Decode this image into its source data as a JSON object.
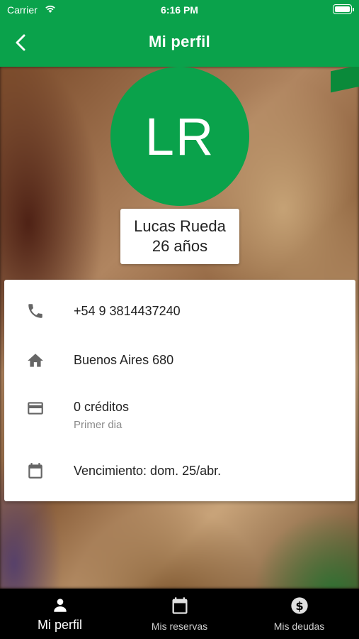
{
  "status_bar": {
    "carrier": "Carrier",
    "time": "6:16 PM"
  },
  "header": {
    "title": "Mi perfil",
    "back_icon": "chevron-left-icon"
  },
  "profile": {
    "initials": "LR",
    "name": "Lucas Rueda",
    "age": "26 años"
  },
  "info": {
    "phone": {
      "icon": "phone-icon",
      "text": "+54 9 3814437240"
    },
    "address": {
      "icon": "home-icon",
      "text": "Buenos Aires 680"
    },
    "credits": {
      "icon": "credit-card-icon",
      "text": "0 créditos",
      "subtext": "Primer dia"
    },
    "expiry": {
      "icon": "calendar-icon",
      "text": "Vencimiento: dom. 25/abr."
    }
  },
  "tabs": [
    {
      "label": "Mi perfil",
      "icon": "person-icon",
      "active": true
    },
    {
      "label": "Mis reservas",
      "icon": "calendar-icon",
      "active": false
    },
    {
      "label": "Mis deudas",
      "icon": "dollar-circle-icon",
      "active": false
    }
  ],
  "colors": {
    "brand_green": "#0aa24b",
    "tabbar_bg": "#000000",
    "card_bg": "#ffffff"
  }
}
